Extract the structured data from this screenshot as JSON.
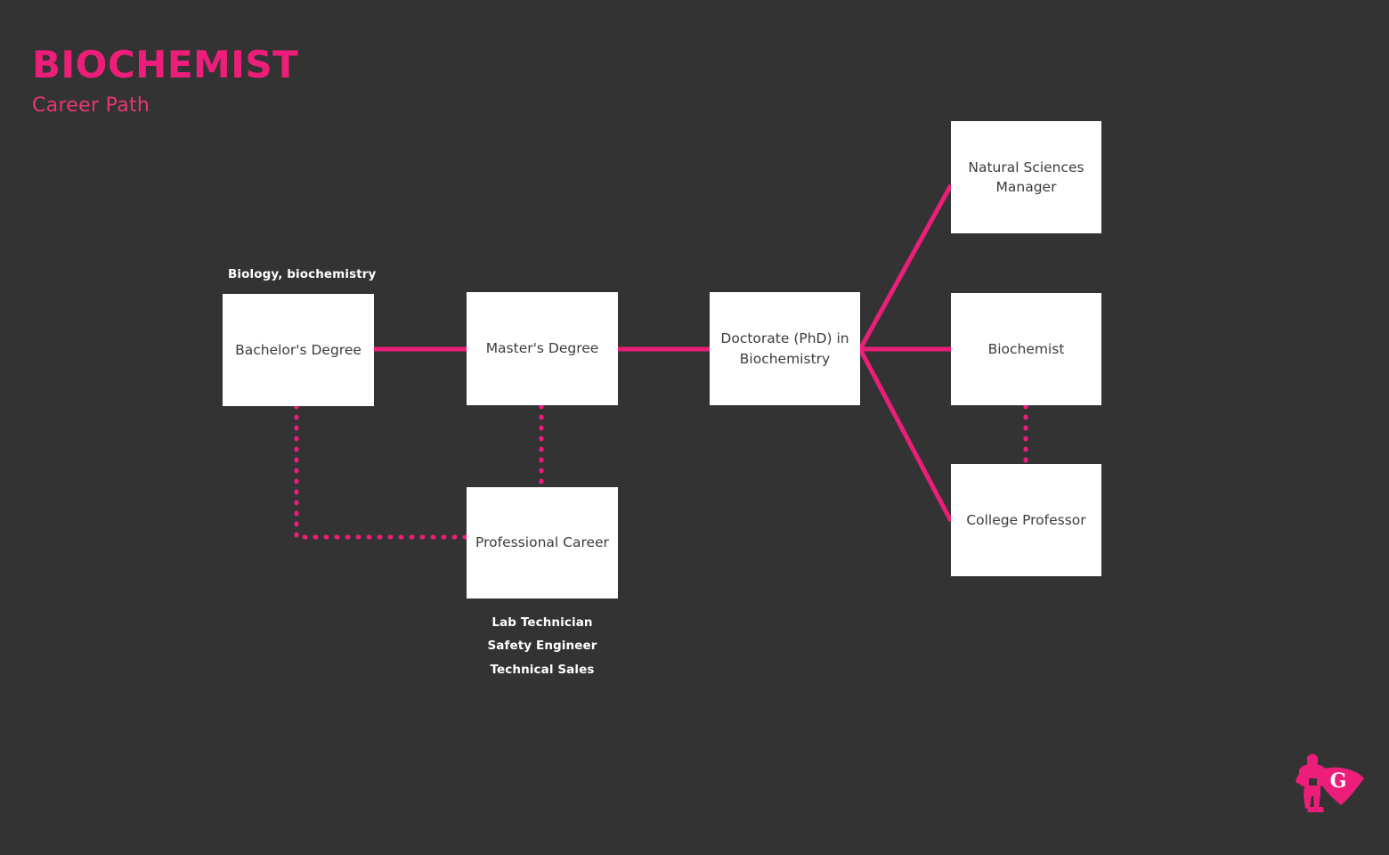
{
  "header": {
    "title": "BIOCHEMIST",
    "subtitle": "Career Path"
  },
  "colors": {
    "background": "#333333",
    "accent": "#ED1E79",
    "node_fill": "#FFFFFF",
    "node_text": "#3C3C3C",
    "caption_text": "#FFFFFF"
  },
  "chart_data": {
    "type": "diagram",
    "title": "BIOCHEMIST Career Path",
    "nodes": [
      {
        "id": "bachelor",
        "label": "Bachelor's Degree"
      },
      {
        "id": "master",
        "label": "Master's Degree"
      },
      {
        "id": "doctorate",
        "label": "Doctorate (PhD) in Biochemistry"
      },
      {
        "id": "natsci",
        "label": "Natural Sciences Manager"
      },
      {
        "id": "biochem",
        "label": "Biochemist"
      },
      {
        "id": "professor",
        "label": "College Professor"
      },
      {
        "id": "career",
        "label": "Professional Career"
      }
    ],
    "edges": [
      {
        "from": "bachelor",
        "to": "master",
        "style": "solid"
      },
      {
        "from": "master",
        "to": "doctorate",
        "style": "solid"
      },
      {
        "from": "doctorate",
        "to": "natsci",
        "style": "solid"
      },
      {
        "from": "doctorate",
        "to": "biochem",
        "style": "solid"
      },
      {
        "from": "doctorate",
        "to": "professor",
        "style": "solid"
      },
      {
        "from": "bachelor",
        "to": "career",
        "style": "dotted"
      },
      {
        "from": "master",
        "to": "career",
        "style": "dotted"
      },
      {
        "from": "biochem",
        "to": "professor",
        "style": "dotted"
      }
    ]
  },
  "nodes": {
    "bachelor": {
      "label": "Bachelor's Degree"
    },
    "master": {
      "label": "Master's Degree"
    },
    "doctorate": {
      "label": "Doctorate (PhD) in Biochemistry"
    },
    "natsci": {
      "label": "Natural Sciences Manager"
    },
    "biochem": {
      "label": "Biochemist"
    },
    "professor": {
      "label": "College Professor"
    },
    "career": {
      "label": "Professional Career"
    }
  },
  "captions": {
    "bachelor_field": "Biology, biochemistry",
    "career_roles": [
      "Lab Technician",
      "Safety Engineer",
      "Technical Sales"
    ]
  },
  "logo": {
    "name": "superhero-g-logo",
    "letter": "G"
  }
}
